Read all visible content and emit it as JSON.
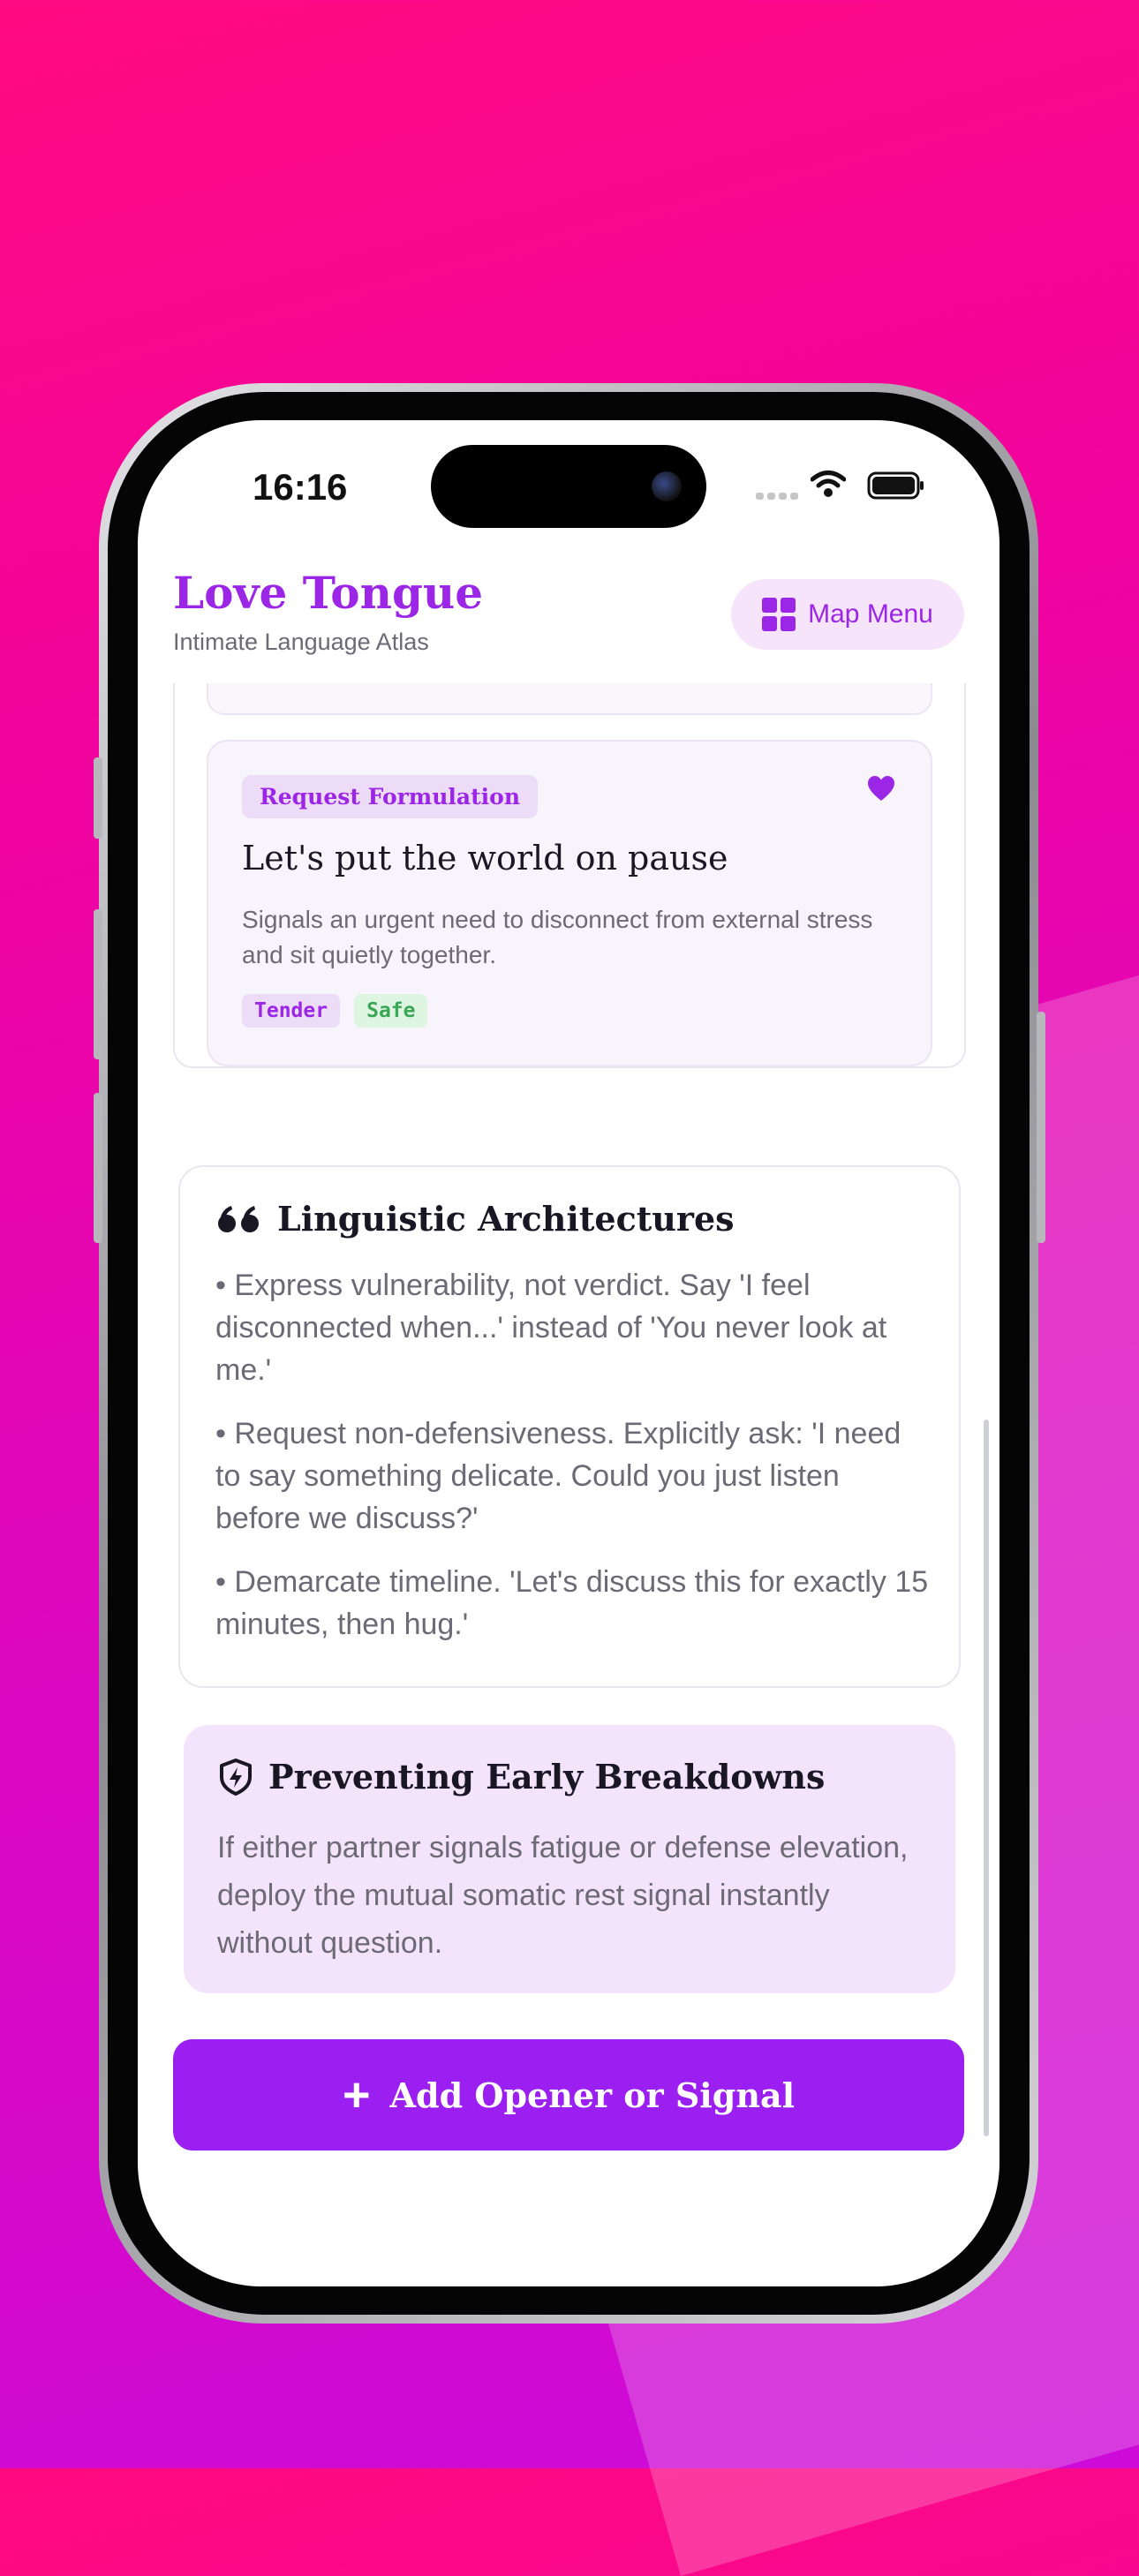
{
  "status": {
    "time": "16:16"
  },
  "header": {
    "title": "Love Tongue",
    "subtitle": "Intimate Language Atlas",
    "menu_label": "Map Menu"
  },
  "signal_card": {
    "badge": "Request Formulation",
    "title": "Let's put the world on pause",
    "description": "Signals an urgent need to disconnect from external stress and sit quietly together.",
    "tags": [
      "Tender",
      "Safe"
    ]
  },
  "linguistic": {
    "title": "Linguistic Architectures",
    "items": [
      "• Express vulnerability, not verdict. Say 'I feel disconnected when...' instead of 'You never look at me.'",
      "• Request non-defensiveness. Explicitly ask: 'I need to say something delicate. Could you just listen before we discuss?'",
      "• Demarcate timeline. 'Let's discuss this for exactly 15 minutes, then hug.'"
    ]
  },
  "prevention": {
    "title": "Preventing Early Breakdowns",
    "text": "If either partner signals fatigue or defense elevation, deploy the mutual somatic rest signal instantly without question."
  },
  "actions": {
    "add_label": "Add Opener or Signal"
  },
  "colors": {
    "accent": "#9b26e6",
    "button": "#9b1ff0",
    "safe": "#3aa757"
  }
}
